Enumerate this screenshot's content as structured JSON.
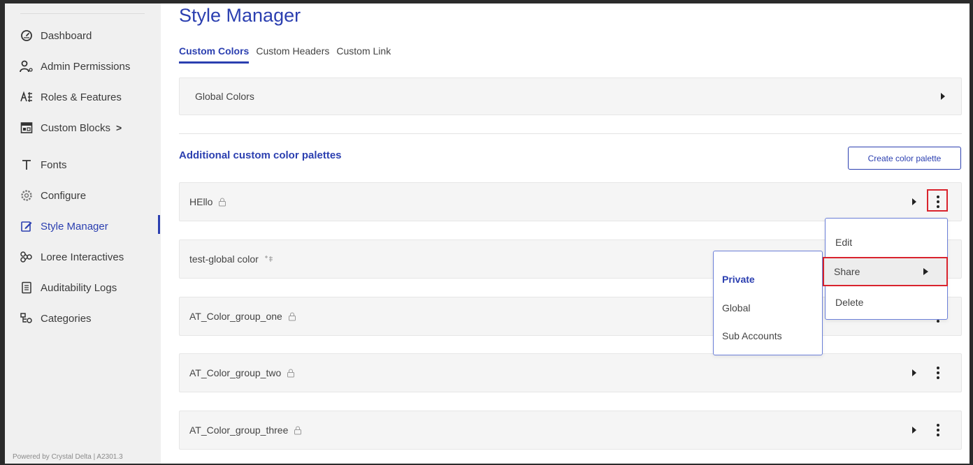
{
  "sidebar": {
    "items": [
      {
        "label": "Dashboard",
        "icon": "gauge-icon"
      },
      {
        "label": "Admin Permissions",
        "icon": "admin-user-icon"
      },
      {
        "label": "Roles & Features",
        "icon": "roles-icon"
      },
      {
        "label": "Custom Blocks",
        "icon": "blocks-icon",
        "has_chevron": true
      },
      {
        "label": "Fonts",
        "icon": "font-icon"
      },
      {
        "label": "Configure",
        "icon": "configure-icon"
      },
      {
        "label": "Style Manager",
        "icon": "edit-icon",
        "active": true
      },
      {
        "label": "Loree Interactives",
        "icon": "interactives-icon"
      },
      {
        "label": "Auditability Logs",
        "icon": "log-icon"
      },
      {
        "label": "Categories",
        "icon": "categories-icon"
      }
    ],
    "chevron": ">",
    "footer": "Powered by Crystal Delta | A2301.3"
  },
  "page": {
    "title": "Style Manager",
    "tabs": [
      "Custom Colors",
      "Custom Headers",
      "Custom Link"
    ],
    "active_tab": "Custom Colors"
  },
  "global_colors": {
    "label": "Global Colors"
  },
  "palettes_section": {
    "title": "Additional custom color palettes",
    "create_button": "Create color palette"
  },
  "palettes": [
    {
      "name": "HEllo",
      "icon": "lock-icon"
    },
    {
      "name": "test-global color",
      "icon": "global-share-icon"
    },
    {
      "name": "AT_Color_group_one",
      "icon": "lock-icon"
    },
    {
      "name": "AT_Color_group_two",
      "icon": "lock-icon"
    },
    {
      "name": "AT_Color_group_three",
      "icon": "lock-icon"
    }
  ],
  "context_menu": {
    "items": [
      "Edit",
      "Share",
      "Delete"
    ]
  },
  "share_submenu": {
    "items": [
      "Private",
      "Global",
      "Sub Accounts"
    ],
    "selected": "Private"
  },
  "colors": {
    "accent": "#2b3fb0",
    "highlight": "#d9232d",
    "sidebar_bg": "#f0f0f0",
    "row_bg": "#f5f5f5"
  }
}
